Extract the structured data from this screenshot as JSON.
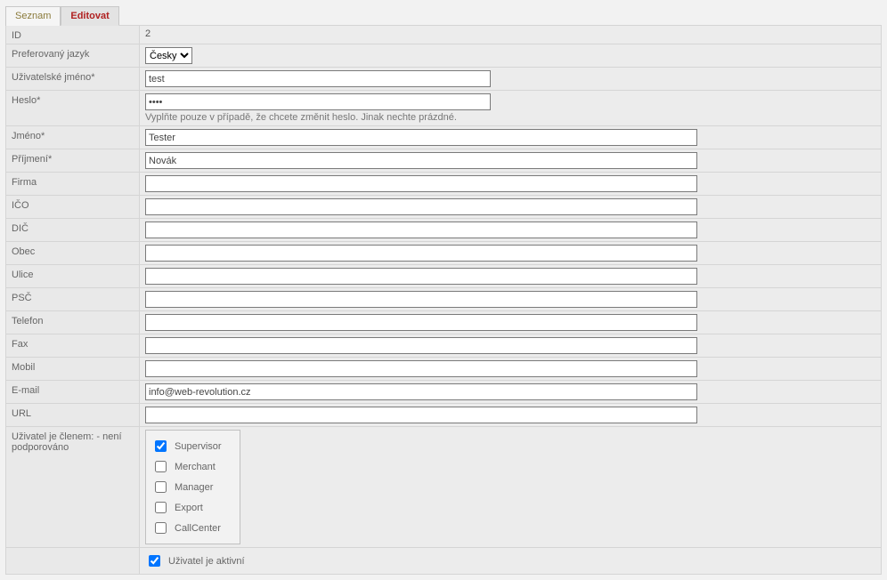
{
  "tabs": {
    "list": "Seznam",
    "edit": "Editovat"
  },
  "labels": {
    "id": "ID",
    "lang": "Preferovaný jazyk",
    "username": "Uživatelské jméno*",
    "password": "Heslo*",
    "passwordHint": "Vyplňte pouze v případě, že chcete změnit heslo. Jinak nechte prázdné.",
    "firstname": "Jméno*",
    "lastname": "Příjmení*",
    "company": "Firma",
    "ico": "IČO",
    "dic": "DIČ",
    "city": "Obec",
    "street": "Ulice",
    "zip": "PSČ",
    "phone": "Telefon",
    "fax": "Fax",
    "mobile": "Mobil",
    "email": "E-mail",
    "url": "URL",
    "member": "Uživatel je členem: - není podporováno",
    "active": "Uživatel je aktivní"
  },
  "values": {
    "id": "2",
    "lang": "Česky",
    "username": "test",
    "password": "••••",
    "firstname": "Tester",
    "lastname": "Novák",
    "company": "",
    "ico": "",
    "dic": "",
    "city": "",
    "street": "",
    "zip": "",
    "phone": "",
    "fax": "",
    "mobile": "",
    "email": "info@web-revolution.cz",
    "url": ""
  },
  "groups": {
    "supervisor": "Supervisor",
    "merchant": "Merchant",
    "manager": "Manager",
    "export": "Export",
    "callcenter": "CallCenter"
  }
}
